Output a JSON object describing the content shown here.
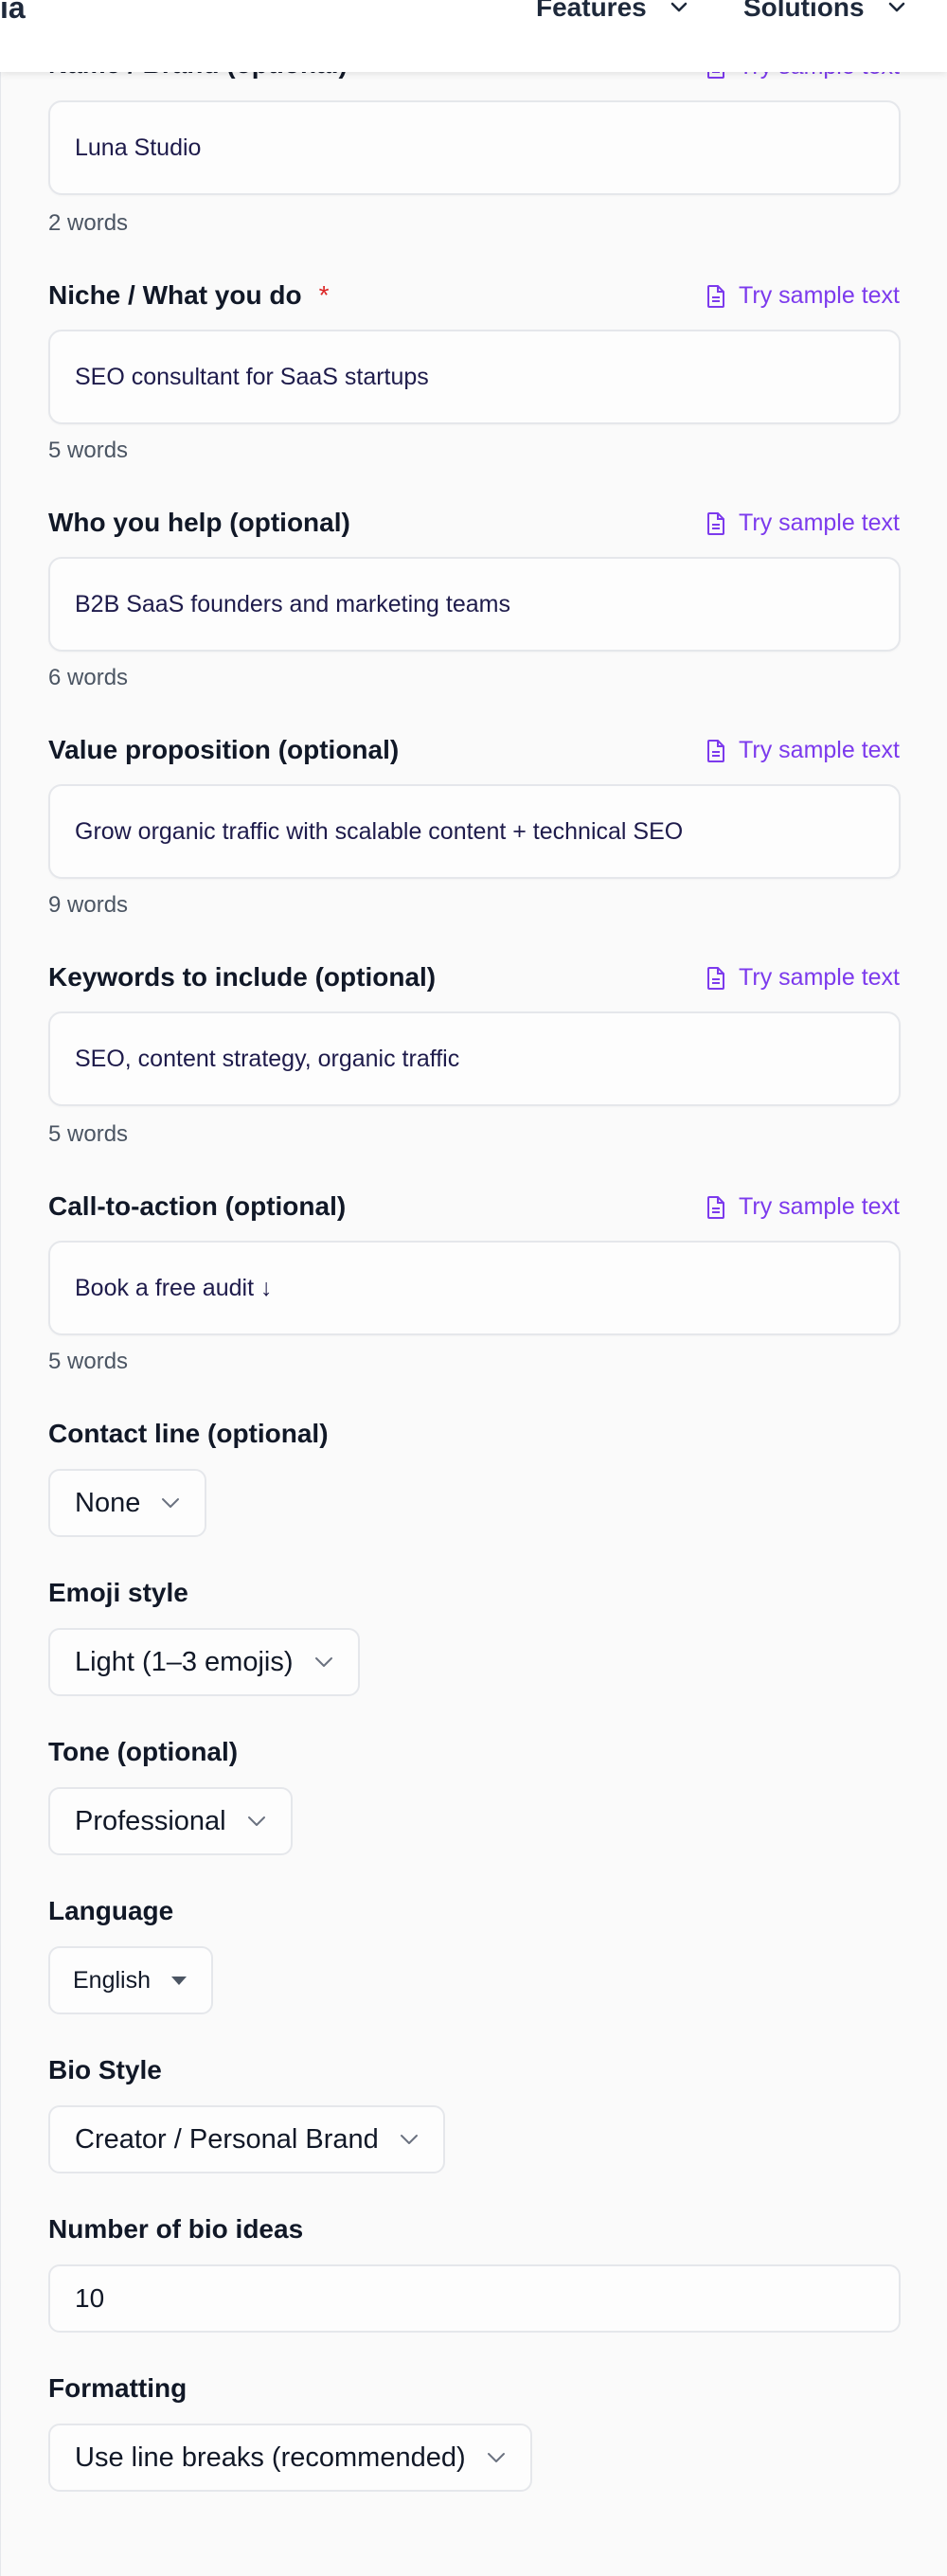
{
  "header": {
    "logo_fragment": "ia",
    "nav": [
      {
        "label": "Features"
      },
      {
        "label": "Solutions"
      }
    ]
  },
  "form": {
    "sample_label": "Try sample text",
    "name": {
      "label": "Name / Brand (optional)",
      "value": "Luna Studio",
      "count": "2 words"
    },
    "niche": {
      "label": "Niche / What you do",
      "required_mark": "*",
      "value": "SEO consultant for SaaS startups",
      "count": "5 words"
    },
    "audience": {
      "label": "Who you help (optional)",
      "value": "B2B SaaS founders and marketing teams",
      "count": "6 words"
    },
    "value_prop": {
      "label": "Value proposition (optional)",
      "value": "Grow organic traffic with scalable content + technical SEO",
      "count": "9 words"
    },
    "keywords": {
      "label": "Keywords to include (optional)",
      "value": "SEO, content strategy, organic traffic",
      "count": "5 words"
    },
    "cta": {
      "label": "Call-to-action (optional)",
      "value": "Book a free audit ↓",
      "count": "5 words"
    },
    "contact": {
      "label": "Contact line (optional)",
      "value": "None"
    },
    "emoji": {
      "label": "Emoji style",
      "value": "Light (1–3 emojis)"
    },
    "tone": {
      "label": "Tone (optional)",
      "value": "Professional"
    },
    "language": {
      "label": "Language",
      "value": "English"
    },
    "bio_style": {
      "label": "Bio Style",
      "value": "Creator / Personal Brand"
    },
    "num_ideas": {
      "label": "Number of bio ideas",
      "value": "10"
    },
    "formatting": {
      "label": "Formatting",
      "value": "Use line breaks (recommended)"
    }
  },
  "colors": {
    "accent": "#7c3aed",
    "required": "#dc2626",
    "text": "#111827"
  }
}
